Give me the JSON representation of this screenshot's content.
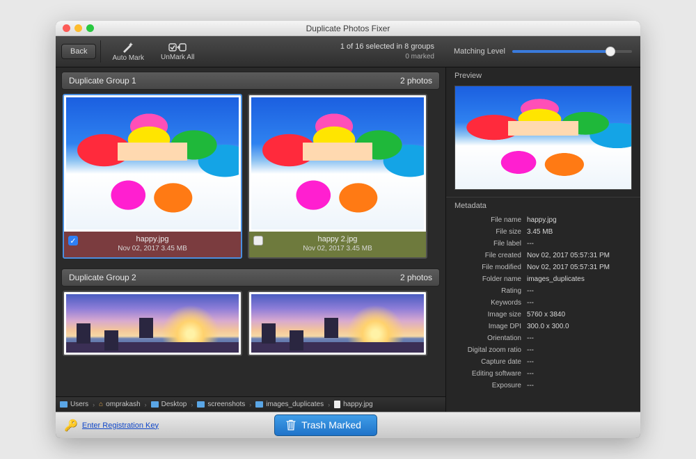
{
  "window": {
    "title": "Duplicate Photos Fixer"
  },
  "toolbar": {
    "back": "Back",
    "automark": "Auto Mark",
    "unmarkall": "UnMark All",
    "status_line1": "1 of 16 selected in 8 groups",
    "status_line2": "0 marked"
  },
  "sidebar": {
    "matching_label": "Matching Level",
    "preview_label": "Preview",
    "metadata_label": "Metadata",
    "metadata": [
      {
        "k": "File name",
        "v": "happy.jpg"
      },
      {
        "k": "File size",
        "v": "3.45 MB"
      },
      {
        "k": "File label",
        "v": "---"
      },
      {
        "k": "File created",
        "v": "Nov 02, 2017 05:57:31 PM"
      },
      {
        "k": "File modified",
        "v": "Nov 02, 2017 05:57:31 PM"
      },
      {
        "k": "Folder name",
        "v": "images_duplicates"
      },
      {
        "k": "Rating",
        "v": "---"
      },
      {
        "k": "Keywords",
        "v": "---"
      },
      {
        "k": "Image size",
        "v": "5760 x 3840"
      },
      {
        "k": "Image DPI",
        "v": "300.0 x 300.0"
      },
      {
        "k": "Orientation",
        "v": "---"
      },
      {
        "k": "Digital zoom ratio",
        "v": "---"
      },
      {
        "k": "Capture date",
        "v": "---"
      },
      {
        "k": "Editing software",
        "v": "---"
      },
      {
        "k": "Exposure",
        "v": "---"
      }
    ]
  },
  "groups": [
    {
      "title": "Duplicate Group 1",
      "count": "2 photos",
      "items": [
        {
          "filename": "happy.jpg",
          "date": "Nov 02, 2017  3.45 MB",
          "checked": true,
          "scene": "ski"
        },
        {
          "filename": "happy 2.jpg",
          "date": "Nov 02, 2017  3.45 MB",
          "checked": false,
          "scene": "ski"
        }
      ]
    },
    {
      "title": "Duplicate Group 2",
      "count": "2 photos",
      "items": [
        {
          "filename": "",
          "date": "",
          "checked": false,
          "scene": "sunset"
        },
        {
          "filename": "",
          "date": "",
          "checked": false,
          "scene": "sunset"
        }
      ]
    }
  ],
  "breadcrumb": [
    "Users",
    "omprakash",
    "Desktop",
    "screenshots",
    "images_duplicates",
    "happy.jpg"
  ],
  "bottom": {
    "registration": "Enter Registration Key",
    "trash": "Trash Marked"
  }
}
